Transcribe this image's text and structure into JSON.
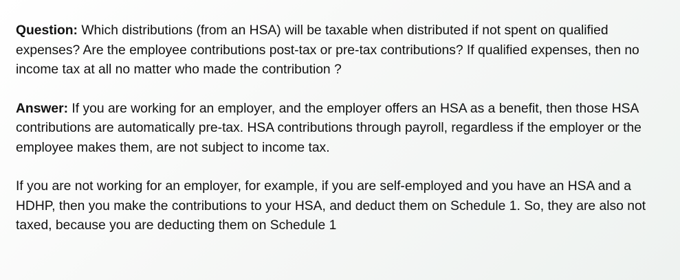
{
  "question": {
    "label": "Question:",
    "text": "  Which distributions (from an HSA) will be taxable when distributed if not spent on qualified expenses?  Are the employee contributions post-tax or pre-tax contributions?  If qualified expenses, then no income tax at all no matter who made the contribution ?"
  },
  "answer": {
    "label": "Answer:",
    "text": "  If you are working for an employer, and the employer offers an HSA as a benefit, then those HSA contributions are automatically pre-tax. HSA contributions through payroll, regardless if the employer or the employee makes them, are not subject to income tax."
  },
  "note": {
    "text": "If you are not working for an employer, for example, if you are self-employed and you have an HSA and a HDHP, then you make the contributions to your HSA, and deduct them on Schedule 1. So, they are also not taxed, because you are deducting them on Schedule 1"
  }
}
